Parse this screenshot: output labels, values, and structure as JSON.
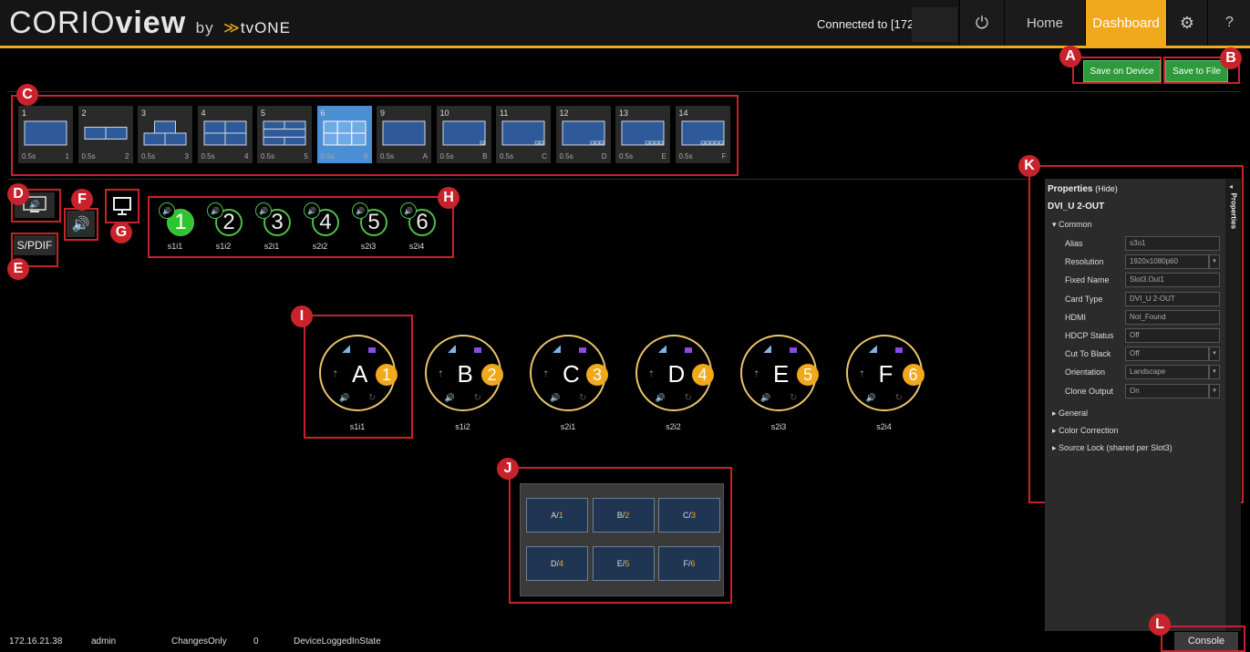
{
  "header": {
    "logo_main": "CORIO",
    "logo_bold": "view",
    "logo_by": "by",
    "logo_brand": "tvONE",
    "connected": "Connected to [172.",
    "nav": {
      "power": "⏻",
      "home": "Home",
      "dashboard": "Dashboard",
      "settings": "⚙",
      "help": "?"
    }
  },
  "save": {
    "device": "Save on Device",
    "file": "Save to File"
  },
  "callouts": [
    "A",
    "B",
    "C",
    "D",
    "E",
    "F",
    "G",
    "H",
    "I",
    "J",
    "K",
    "L"
  ],
  "presets": [
    {
      "num": "1",
      "time": "0.5s",
      "label": "1",
      "layout": "1"
    },
    {
      "num": "2",
      "time": "0.5s",
      "label": "2",
      "layout": "2"
    },
    {
      "num": "3",
      "time": "0.5s",
      "label": "3",
      "layout": "3"
    },
    {
      "num": "4",
      "time": "0.5s",
      "label": "4",
      "layout": "4"
    },
    {
      "num": "5",
      "time": "0.5s",
      "label": "5",
      "layout": "5"
    },
    {
      "num": "6",
      "time": "0.5s",
      "label": "6",
      "layout": "6",
      "selected": true
    },
    {
      "num": "9",
      "time": "0.5s",
      "label": "A",
      "layout": "A"
    },
    {
      "num": "10",
      "time": "0.5s",
      "label": "B",
      "layout": "B"
    },
    {
      "num": "11",
      "time": "0.5s",
      "label": "C",
      "layout": "C"
    },
    {
      "num": "12",
      "time": "0.5s",
      "label": "D",
      "layout": "D"
    },
    {
      "num": "13",
      "time": "0.5s",
      "label": "E",
      "layout": "E"
    },
    {
      "num": "14",
      "time": "0.5s",
      "label": "F",
      "layout": "F"
    }
  ],
  "left_controls": {
    "spdif": "S/PDIF"
  },
  "sources": [
    {
      "num": "1",
      "label": "s1i1",
      "active": true
    },
    {
      "num": "2",
      "label": "s1i2"
    },
    {
      "num": "3",
      "label": "s2i1"
    },
    {
      "num": "4",
      "label": "s2i2"
    },
    {
      "num": "5",
      "label": "s2i3"
    },
    {
      "num": "6",
      "label": "s2i4"
    }
  ],
  "outputs": [
    {
      "letter": "A",
      "num": "1",
      "label": "s1i1"
    },
    {
      "letter": "B",
      "num": "2",
      "label": "s1i2"
    },
    {
      "letter": "C",
      "num": "3",
      "label": "s2i1"
    },
    {
      "letter": "D",
      "num": "4",
      "label": "s2i2"
    },
    {
      "letter": "E",
      "num": "5",
      "label": "s2i3"
    },
    {
      "letter": "F",
      "num": "6",
      "label": "s2i4"
    }
  ],
  "grid": [
    {
      "win": "A/",
      "src": "1"
    },
    {
      "win": "B/",
      "src": "2"
    },
    {
      "win": "C/",
      "src": "3"
    },
    {
      "win": "D/",
      "src": "4"
    },
    {
      "win": "E/",
      "src": "5"
    },
    {
      "win": "F/",
      "src": "6"
    }
  ],
  "properties": {
    "title": "Properties",
    "hide": "(Hide)",
    "tab": "Properties",
    "device": "DVI_U 2-OUT",
    "common": "Common",
    "rows": [
      {
        "label": "Alias",
        "value": "s3o1"
      },
      {
        "label": "Resolution",
        "value": "1920x1080p60",
        "dropdown": true
      },
      {
        "label": "Fixed Name",
        "value": "Slot3.Out1"
      },
      {
        "label": "Card Type",
        "value": "DVI_U 2-OUT"
      },
      {
        "label": "HDMI",
        "value": "Not_Found"
      },
      {
        "label": "HDCP Status",
        "value": "Off"
      },
      {
        "label": "Cut To Black",
        "value": "Off",
        "dropdown": true
      },
      {
        "label": "Orientation",
        "value": "Landscape",
        "dropdown": true
      },
      {
        "label": "Clone Output",
        "value": "On",
        "dropdown": true
      }
    ],
    "sections": [
      "General",
      "Color Correction",
      "Source Lock (shared per Slot3)"
    ]
  },
  "status": {
    "ip": "172.16.21.38",
    "user": "admin",
    "mode": "ChangesOnly",
    "count": "0",
    "state": "DeviceLoggedInState"
  },
  "console": "Console",
  "colors": {
    "accent": "#f0a81c",
    "callout": "#c8232c",
    "save": "#2d9a3c",
    "source_active": "#2cc52c"
  }
}
